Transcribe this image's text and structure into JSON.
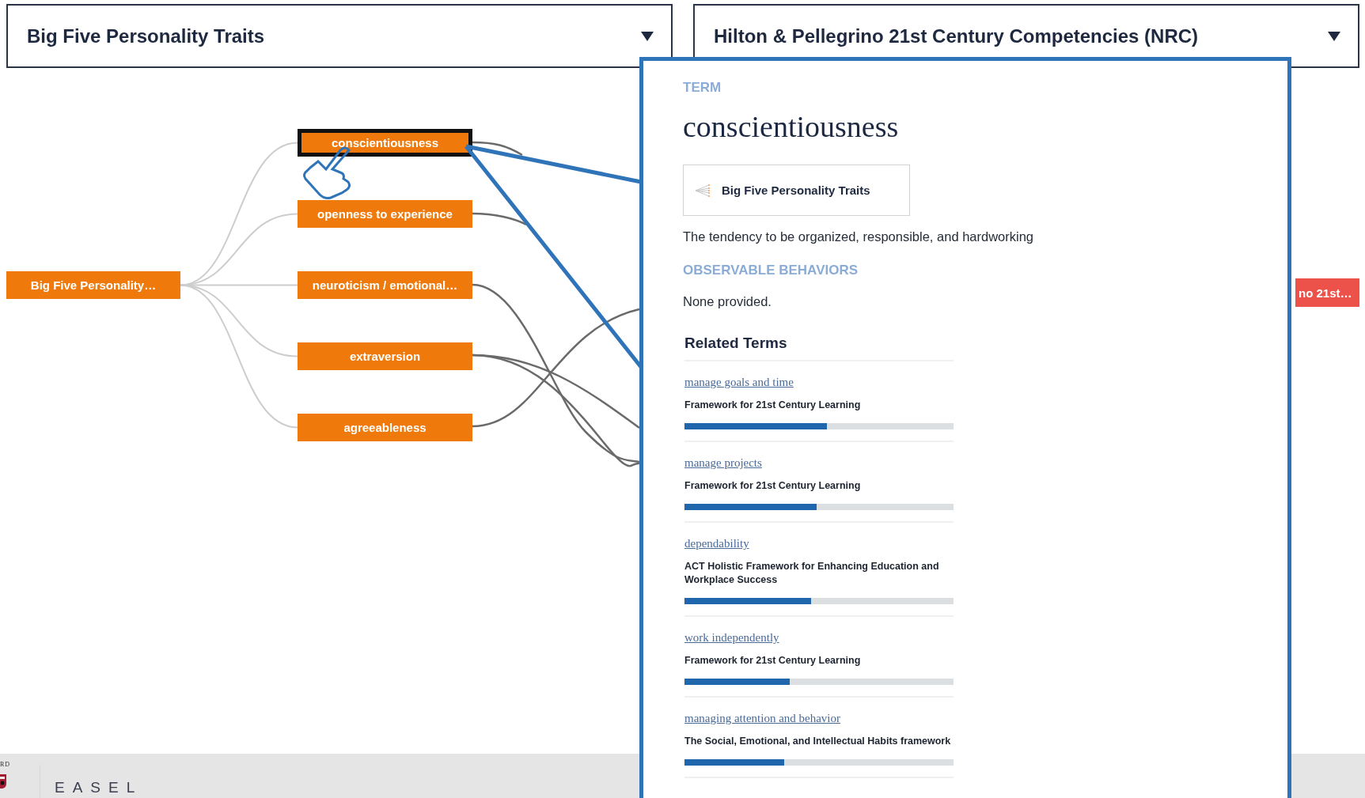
{
  "dropdowns": [
    {
      "label": "Big Five Personality Traits"
    },
    {
      "label": "Hilton & Pellegrino 21st Century Competencies (NRC)"
    }
  ],
  "tree": {
    "root": "Big Five Personality…",
    "children": [
      {
        "label": "conscientiousness",
        "selected": true
      },
      {
        "label": "openness to experience",
        "selected": false
      },
      {
        "label": "neuroticism / emotional…",
        "selected": false
      },
      {
        "label": "extraversion",
        "selected": false
      },
      {
        "label": "agreeableness",
        "selected": false
      }
    ]
  },
  "target_node": {
    "label": "no 21st…"
  },
  "term_card": {
    "heading": "TERM",
    "term": "conscientiousness",
    "framework": "Big Five Personality Traits",
    "description": "The tendency to be organized, responsible, and hardworking",
    "behaviors_heading": "OBSERVABLE BEHAVIORS",
    "behaviors": "None provided.",
    "related_heading": "Related Terms",
    "related": [
      {
        "term": "manage goals and time",
        "framework": "Framework for 21st Century Learning",
        "level": 0.53
      },
      {
        "term": "manage projects",
        "framework": "Framework for 21st Century Learning",
        "level": 0.49
      },
      {
        "term": "dependability",
        "framework": "ACT Holistic Framework for Enhancing Education and Workplace Success",
        "level": 0.47
      },
      {
        "term": "work independently",
        "framework": "Framework for 21st Century Learning",
        "level": 0.39
      },
      {
        "term": "managing attention and behavior",
        "framework": "The Social, Emotional, and Intellectual Habits framework",
        "level": 0.37
      }
    ]
  },
  "footer": {
    "logo_text": "RD",
    "brand": "EASEL"
  }
}
